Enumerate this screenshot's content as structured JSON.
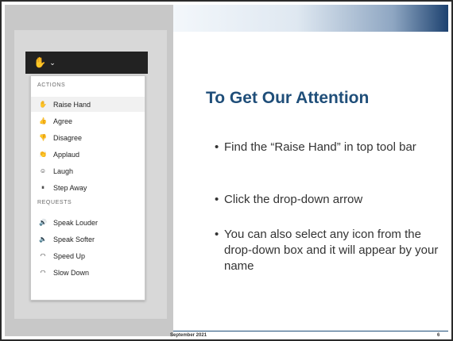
{
  "slide": {
    "title": "To Get Our Attention",
    "bullets": [
      "Find the “Raise Hand” in top tool bar",
      "Click the drop-down arrow",
      "You can also select any icon from the drop-down box and it will appear by your name"
    ],
    "footer_date": "September 2021",
    "page_number": "6"
  },
  "menu": {
    "header_icon": "raise-hand-icon",
    "header_chevron": "chevron-down-icon",
    "sections": [
      {
        "label": "ACTIONS",
        "items": [
          {
            "label": "Raise Hand",
            "icon": "raise-hand-icon",
            "glyph": "✋"
          },
          {
            "label": "Agree",
            "icon": "thumbs-up-icon",
            "glyph": "👍"
          },
          {
            "label": "Disagree",
            "icon": "thumbs-down-icon",
            "glyph": "👎"
          },
          {
            "label": "Applaud",
            "icon": "clapping-hands-icon",
            "glyph": "👏"
          },
          {
            "label": "Laugh",
            "icon": "laugh-face-icon",
            "glyph": "☺"
          },
          {
            "label": "Step Away",
            "icon": "step-away-icon",
            "glyph": "⏸"
          }
        ]
      },
      {
        "label": "REQUESTS",
        "items": [
          {
            "label": "Speak Louder",
            "icon": "speaker-louder-icon",
            "glyph": "🔊"
          },
          {
            "label": "Speak Softer",
            "icon": "speaker-softer-icon",
            "glyph": "🔈"
          },
          {
            "label": "Speed Up",
            "icon": "speed-up-icon",
            "glyph": "◠"
          },
          {
            "label": "Slow Down",
            "icon": "slow-down-icon",
            "glyph": "◠"
          }
        ]
      }
    ]
  },
  "colors": {
    "title": "#1f4e79",
    "menu_header_bg": "#222222",
    "gradient_end": "#1d4270"
  }
}
